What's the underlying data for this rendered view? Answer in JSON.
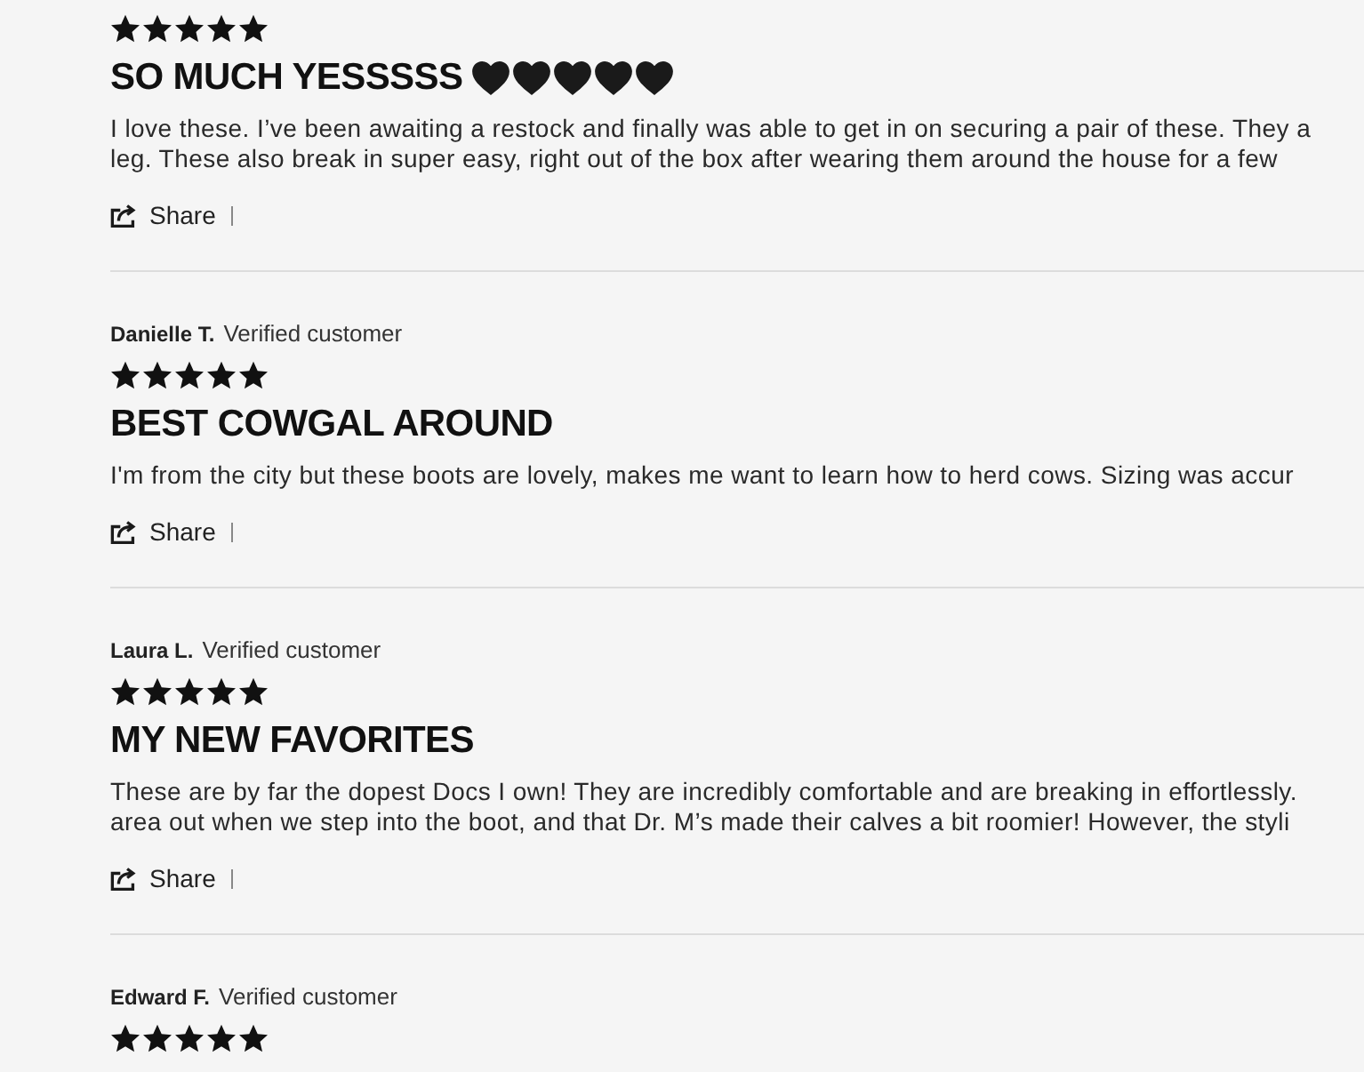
{
  "reviews": [
    {
      "stars": 5,
      "title": "SO MUCH YESSSSS",
      "title_icons": [
        {
          "kind": "heart"
        },
        {
          "kind": "heart"
        },
        {
          "kind": "heart"
        },
        {
          "kind": "heart"
        },
        {
          "kind": "heart"
        }
      ],
      "body_lines": [
        "I love these. I’ve been awaiting a restock and finally was able to get in on securing a pair of these. They a",
        "leg. These also break in super easy, right out of the box after wearing them around the house for a few"
      ],
      "share": "Share"
    },
    {
      "reviewer": "Danielle T.",
      "badge": "Verified customer",
      "stars": 5,
      "title": "BEST COWGAL AROUND",
      "body_lines": [
        "I'm from the city but these boots are lovely, makes me want to learn how to herd cows. Sizing was accur"
      ],
      "share": "Share"
    },
    {
      "reviewer": "Laura L.",
      "badge": "Verified customer",
      "stars": 5,
      "title": "MY NEW FAVORITES",
      "body_lines": [
        "These are by far the dopest Docs I own! They are incredibly comfortable and are breaking in effortlessly.",
        "area out when we step into the boot, and that Dr. M’s made their calves a bit roomier! However, the styli"
      ],
      "share": "Share"
    },
    {
      "reviewer": "Edward F.",
      "badge": "Verified customer",
      "stars": 5
    }
  ]
}
